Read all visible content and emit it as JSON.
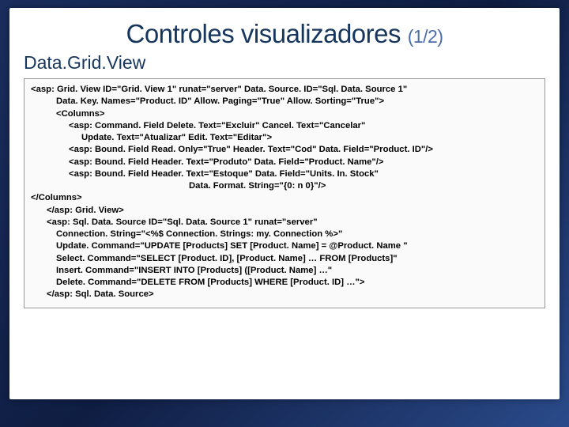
{
  "title": "Controles visualizadores",
  "title_suffix": "(1/2)",
  "subtitle": "Data.Grid.View",
  "code": {
    "l1": "<asp: Grid. View ID=\"Grid. View 1\" runat=\"server\" Data. Source. ID=\"Sql. Data. Source 1\"",
    "l2": "Data. Key. Names=\"Product. ID\" Allow. Paging=\"True\" Allow. Sorting=\"True\">",
    "l3": "<Columns>",
    "l4": "<asp: Command. Field Delete. Text=\"Excluir\" Cancel. Text=\"Cancelar\"",
    "l5": "Update. Text=\"Atualizar\" Edit. Text=\"Editar\">",
    "l6": "<asp: Bound. Field Read. Only=\"True\" Header. Text=\"Cod\" Data. Field=\"Product. ID\"/>",
    "l7": "<asp: Bound. Field Header. Text=\"Produto\" Data. Field=\"Product. Name\"/>",
    "l8": "<asp: Bound. Field Header. Text=\"Estoque\" Data. Field=\"Units. In. Stock\"",
    "l9": "Data. Format. String=\"{0: n 0}\"/>",
    "l10": "</Columns>",
    "l11": "</asp: Grid. View>",
    "l12": "<asp: Sql. Data. Source ID=\"Sql. Data. Source 1\" runat=\"server\"",
    "l13": "Connection. String=\"<%$ Connection. Strings: my. Connection %>\"",
    "l14": "Update. Command=\"UPDATE [Products] SET [Product. Name] = @Product. Name \"",
    "l15": "Select. Command=\"SELECT [Product. ID], [Product. Name] … FROM [Products]\"",
    "l16": "Insert. Command=\"INSERT INTO [Products] ([Product. Name] …\"",
    "l17": "Delete. Command=\"DELETE FROM [Products] WHERE [Product. ID] …\">",
    "l18": "</asp: Sql. Data. Source>"
  }
}
